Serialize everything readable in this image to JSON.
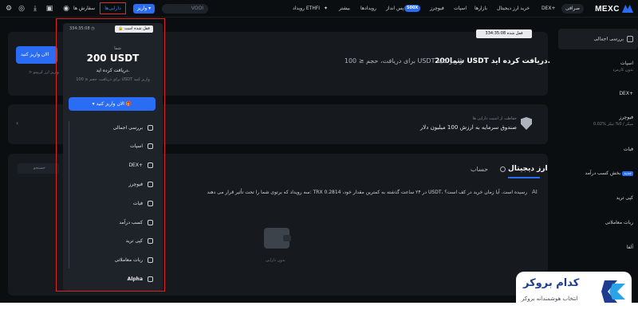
{
  "topnav": {
    "logo": "MEXC",
    "exchange_label": "صرافی",
    "dex_label": "DEX+",
    "items": [
      "خرید ارز دیجیتال",
      "بازارها",
      "اسپات",
      "فیوچرز",
      "پس انداز",
      "رویدادها",
      "بیشتر",
      "رویداد ETHFI"
    ],
    "futures_badge": "500X",
    "search_placeholder": "VOOI",
    "deposit_label": "واریز",
    "assets_label": "دارایی‌ها",
    "orders_label": "سفارش ها"
  },
  "sidebar": {
    "overview": "بررسی اجمالی",
    "spot": "اسپات",
    "spot_sub": "بدون کارمزد",
    "dex": "DEX+",
    "futures": "فیوچرز",
    "futures_sub": "0.02% میکر / 0% تیکر",
    "fiat": "فیات",
    "earn": "بخش کسب درآمد",
    "earn_badge": "جدید",
    "copy": "کپی ترید",
    "bots": "ربات معاملاتی",
    "alpha": "آلفا"
  },
  "banner": {
    "title": "شما200 USDT دریافت کرده اید.",
    "sub": "برای دریافت، حجم ≤ 100 USDT واریز کنید",
    "timer_chip": "قفل شده 334:35:08",
    "left_deposit": "الان واریز کنید",
    "left_link": "> واریز ارز کریپتو"
  },
  "protection": {
    "title": "حفاظت از امنیت دارایی ها",
    "text": "صندوق سرمایه به ارزش 100 میلیون دلار"
  },
  "assets_section": {
    "tab_crypto": "ارز دیجیتال",
    "tab_account": "حساب",
    "alert": "سه رویداد که برتوی شما را تحت تأثیر قرار می دهند: TRX در ۲۴ ساعت گذشته به کمترین مقدار خود، 0.2814 USDT، رسیده است. آیا زمان خرید در کف است؟",
    "search_placeholder": "جستجو",
    "empty": "بدون دارایی"
  },
  "dropdown": {
    "chip": "قفل شده است",
    "timer": "334:35:08",
    "you": "شما",
    "amount": "200 USDT",
    "received": "دریافت کرده اید.",
    "condition": "برای دریافت، حجم ≤ 100 USDT واریز کنید",
    "deposit_button": "الان واریز کنید",
    "items": [
      "بررسی اجمالی",
      "اسپات",
      "DEX+",
      "فیوچرز",
      "فیات",
      "کسب درآمد",
      "کپی ترید",
      "ربات معاملاتی",
      "Alpha"
    ]
  },
  "brand": {
    "name": "کدام بروکر",
    "tagline": "انتخاب هوشمندانه بروکر"
  },
  "colors": {
    "accent": "#2a6df4",
    "highlight": "#d92424",
    "background": "#0b0e11"
  }
}
